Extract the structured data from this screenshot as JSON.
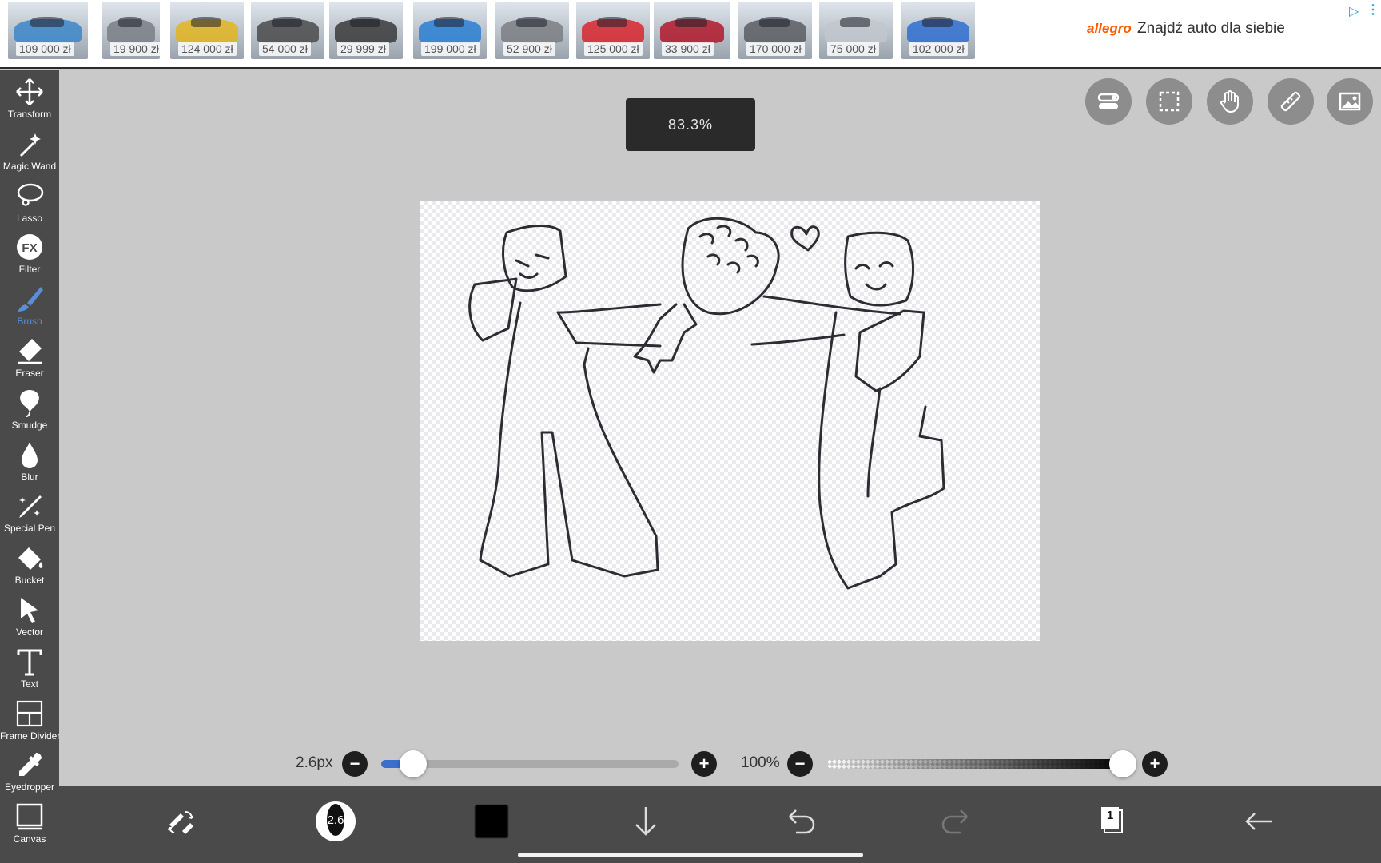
{
  "ad": {
    "cars": [
      {
        "price": "109 000 zł",
        "color": "#3c86c9"
      },
      {
        "price": "19 900 zł",
        "color": "#7a7f86"
      },
      {
        "price": "124 000 zł",
        "color": "#e2b520"
      },
      {
        "price": "54 000 zł",
        "color": "#4a4a4a"
      },
      {
        "price": "29 999 zł",
        "color": "#3a3a3a"
      },
      {
        "price": "199 000 zł",
        "color": "#2a7fd4"
      },
      {
        "price": "52 900 zł",
        "color": "#7b7e82"
      },
      {
        "price": "125 000 zł",
        "color": "#d9262e"
      },
      {
        "price": "33 900 zł",
        "color": "#b0182a"
      },
      {
        "price": "170 000 zł",
        "color": "#5a5d62"
      },
      {
        "price": "75 000 zł",
        "color": "#c2c6cc"
      },
      {
        "price": "102 000 zł",
        "color": "#2f6fcf"
      }
    ],
    "brand": "allegro",
    "text": "Znajdź auto dla siebie",
    "choices_icon": "ad-choices-icon",
    "more_icon": "more-icon"
  },
  "tools": [
    {
      "label": "Transform",
      "icon": "move-icon"
    },
    {
      "label": "Magic Wand",
      "icon": "magic-wand-icon"
    },
    {
      "label": "Lasso",
      "icon": "lasso-icon"
    },
    {
      "label": "Filter",
      "icon": "fx-icon"
    },
    {
      "label": "Brush",
      "icon": "brush-icon",
      "active": true
    },
    {
      "label": "Eraser",
      "icon": "eraser-icon"
    },
    {
      "label": "Smudge",
      "icon": "smudge-icon"
    },
    {
      "label": "Blur",
      "icon": "drop-icon"
    },
    {
      "label": "Special Pen",
      "icon": "special-pen-icon"
    },
    {
      "label": "Bucket",
      "icon": "bucket-icon"
    },
    {
      "label": "Vector",
      "icon": "cursor-arrow-icon"
    },
    {
      "label": "Text",
      "icon": "text-icon"
    },
    {
      "label": "Frame Divider",
      "icon": "frame-divider-icon"
    },
    {
      "label": "Eyedropper",
      "icon": "eyedropper-icon"
    },
    {
      "label": "Canvas",
      "icon": "canvas-icon"
    }
  ],
  "zoom": "83.3%",
  "top_buttons": [
    "toggle-icon",
    "selection-icon",
    "hand-icon",
    "ruler-icon",
    "image-icon"
  ],
  "brush": {
    "size_label": "2.6px",
    "size_level": 0.08,
    "size_badge": "2.6",
    "opacity_label": "100%",
    "opacity_level": 1.0,
    "minus_symbol": "−",
    "plus_symbol": "+"
  },
  "bottom_toolbar": {
    "color": "#000000",
    "layer_count": "1",
    "icons": [
      "brush-eraser-swap-icon",
      "brush-preview-icon",
      "color-swatch",
      "download-icon",
      "undo-icon",
      "redo-icon",
      "layers-icon",
      "back-arrow-icon"
    ]
  }
}
